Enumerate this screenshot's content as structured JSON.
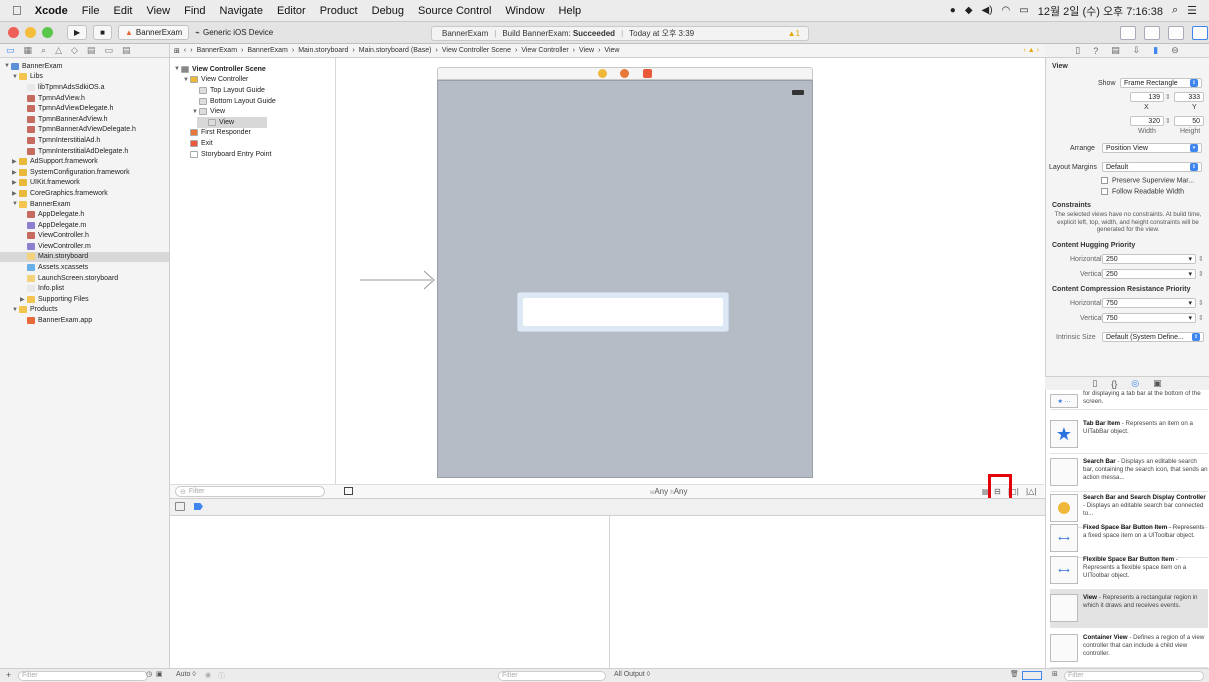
{
  "menubar": {
    "apple": "",
    "items": [
      "Xcode",
      "File",
      "Edit",
      "View",
      "Find",
      "Navigate",
      "Editor",
      "Product",
      "Debug",
      "Source Control",
      "Window",
      "Help"
    ],
    "clock": "12월 2일 (수) 오후 7:16:38"
  },
  "toolbar": {
    "scheme": "BannerExam",
    "device": "Generic iOS Device",
    "status_project": "BannerExam",
    "status_build": "Build BannerExam:",
    "status_result": "Succeeded",
    "status_time": "Today at 오후 3:39",
    "warning_count": "1"
  },
  "jumpbar": [
    "BannerExam",
    "BannerExam",
    "Main.storyboard",
    "Main.storyboard (Base)",
    "View Controller Scene",
    "View Controller",
    "View",
    "View"
  ],
  "navigator": {
    "items": [
      {
        "label": "BannerExam",
        "indent": 0,
        "tri": "▼",
        "color": "#5b8fd8",
        "sel": false
      },
      {
        "label": "Libs",
        "indent": 1,
        "tri": "▼",
        "color": "#f3c44e",
        "sel": false
      },
      {
        "label": "libTpmnAdsSdkiOS.a",
        "indent": 2,
        "tri": "",
        "color": "#e8e8e8",
        "sel": false
      },
      {
        "label": "TpmnAdView.h",
        "indent": 2,
        "tri": "",
        "color": "#c56b5f",
        "sel": false
      },
      {
        "label": "TpmnAdViewDelegate.h",
        "indent": 2,
        "tri": "",
        "color": "#c56b5f",
        "sel": false
      },
      {
        "label": "TpmnBannerAdView.h",
        "indent": 2,
        "tri": "",
        "color": "#c56b5f",
        "sel": false
      },
      {
        "label": "TpmnBannerAdViewDelegate.h",
        "indent": 2,
        "tri": "",
        "color": "#c56b5f",
        "sel": false
      },
      {
        "label": "TpmnInterstitialAd.h",
        "indent": 2,
        "tri": "",
        "color": "#c56b5f",
        "sel": false
      },
      {
        "label": "TpmnInterstitialAdDelegate.h",
        "indent": 2,
        "tri": "",
        "color": "#c56b5f",
        "sel": false
      },
      {
        "label": "AdSupport.framework",
        "indent": 1,
        "tri": "▶",
        "color": "#e8b93a",
        "sel": false
      },
      {
        "label": "SystemConfiguration.framework",
        "indent": 1,
        "tri": "▶",
        "color": "#e8b93a",
        "sel": false
      },
      {
        "label": "UIKit.framework",
        "indent": 1,
        "tri": "▶",
        "color": "#e8b93a",
        "sel": false
      },
      {
        "label": "CoreGraphics.framework",
        "indent": 1,
        "tri": "▶",
        "color": "#e8b93a",
        "sel": false
      },
      {
        "label": "BannerExam",
        "indent": 1,
        "tri": "▼",
        "color": "#f3c44e",
        "sel": false
      },
      {
        "label": "AppDelegate.h",
        "indent": 2,
        "tri": "",
        "color": "#c56b5f",
        "sel": false
      },
      {
        "label": "AppDelegate.m",
        "indent": 2,
        "tri": "",
        "color": "#8c7fd0",
        "sel": false
      },
      {
        "label": "ViewController.h",
        "indent": 2,
        "tri": "",
        "color": "#c56b5f",
        "sel": false
      },
      {
        "label": "ViewController.m",
        "indent": 2,
        "tri": "",
        "color": "#8c7fd0",
        "sel": false
      },
      {
        "label": "Main.storyboard",
        "indent": 2,
        "tri": "",
        "color": "#f3d27a",
        "sel": true
      },
      {
        "label": "Assets.xcassets",
        "indent": 2,
        "tri": "",
        "color": "#6ab0e8",
        "sel": false
      },
      {
        "label": "LaunchScreen.storyboard",
        "indent": 2,
        "tri": "",
        "color": "#f3d27a",
        "sel": false
      },
      {
        "label": "Info.plist",
        "indent": 2,
        "tri": "",
        "color": "#e8e8e8",
        "sel": false
      },
      {
        "label": "Supporting Files",
        "indent": 2,
        "tri": "▶",
        "color": "#f3c44e",
        "sel": false
      },
      {
        "label": "Products",
        "indent": 1,
        "tri": "▼",
        "color": "#f3c44e",
        "sel": false
      },
      {
        "label": "BannerExam.app",
        "indent": 2,
        "tri": "",
        "color": "#e86a3a",
        "sel": false
      }
    ],
    "filter_placeholder": "Filter"
  },
  "outline": {
    "items": [
      {
        "label": "View Controller Scene",
        "indent": 0,
        "tri": "▼",
        "color": "#888",
        "bold": true,
        "sel": false
      },
      {
        "label": "View Controller",
        "indent": 1,
        "tri": "▼",
        "color": "#f0b838",
        "bold": false,
        "sel": false
      },
      {
        "label": "Top Layout Guide",
        "indent": 2,
        "tri": "",
        "color": "#ddd",
        "bold": false,
        "sel": false
      },
      {
        "label": "Bottom Layout Guide",
        "indent": 2,
        "tri": "",
        "color": "#ddd",
        "bold": false,
        "sel": false
      },
      {
        "label": "View",
        "indent": 2,
        "tri": "▼",
        "color": "#ddd",
        "bold": false,
        "sel": false
      },
      {
        "label": "View",
        "indent": 3,
        "tri": "",
        "color": "#ddd",
        "bold": false,
        "sel": true
      },
      {
        "label": "First Responder",
        "indent": 1,
        "tri": "",
        "color": "#e8773a",
        "bold": false,
        "sel": false
      },
      {
        "label": "Exit",
        "indent": 1,
        "tri": "",
        "color": "#e85a3a",
        "bold": false,
        "sel": false
      },
      {
        "label": "Storyboard Entry Point",
        "indent": 1,
        "tri": "",
        "color": "#fff",
        "bold": false,
        "sel": false
      }
    ],
    "filter_placeholder": "Filter"
  },
  "canvas": {
    "size_class": "wAny hAny",
    "w_prefix": "w",
    "w_value": "Any",
    "h_prefix": "h",
    "h_value": "Any"
  },
  "debug": {
    "auto_label": "Auto ◊",
    "filter_placeholder": "Filter",
    "output_label": "All Output ◊"
  },
  "inspector": {
    "section": "View",
    "show_label": "Show",
    "show_value": "Frame Rectangle",
    "x": "139",
    "y": "333",
    "x_label": "X",
    "y_label": "Y",
    "width": "320",
    "height": "50",
    "width_label": "Width",
    "height_label": "Height",
    "arrange_label": "Arrange",
    "arrange_value": "Position View",
    "margins_label": "Layout Margins",
    "margins_value": "Default",
    "preserve_label": "Preserve Superview Mar...",
    "follow_label": "Follow Readable Width",
    "constraints_head": "Constraints",
    "constraints_text": "The selected views have no constraints. At build time, explicit left, top, width, and height constraints will be generated for the view.",
    "hugging_head": "Content Hugging Priority",
    "horizontal_label": "Horizontal",
    "vertical_label": "Vertical",
    "hug_h": "250",
    "hug_v": "250",
    "compression_head": "Content Compression Resistance Priority",
    "comp_h": "750",
    "comp_v": "750",
    "intrinsic_label": "Intrinsic Size",
    "intrinsic_value": "Default (System Define..."
  },
  "library": {
    "items": [
      {
        "title": "",
        "desc": "for displaying a tab bar at the bottom of the screen.",
        "icon": "tab-bar-icon"
      },
      {
        "title": "Tab Bar Item",
        "desc": " - Represents an item on a UITabBar object.",
        "icon": "star-icon"
      },
      {
        "title": "Search Bar",
        "desc": " - Displays an editable search bar, containing the search icon, that sends an action messa...",
        "icon": "search-bar-icon"
      },
      {
        "title": "Search Bar and Search Display Controller",
        "desc": " - Displays an editable search bar connected to...",
        "icon": "search-display-icon"
      },
      {
        "title": "Fixed Space Bar Button Item",
        "desc": " - Represents a fixed space item on a UIToolbar object.",
        "icon": "fixed-space-icon"
      },
      {
        "title": "Flexible Space Bar Button Item",
        "desc": " - Represents a flexible space item on a UIToolbar object.",
        "icon": "flexible-space-icon"
      },
      {
        "title": "View",
        "desc": " - Represents a rectangular region in which it draws and receives events.",
        "icon": "view-icon"
      },
      {
        "title": "Container View",
        "desc": " - Defines a region of a view controller that can include a child view controller.",
        "icon": "container-view-icon"
      }
    ],
    "filter_placeholder": "Filter"
  }
}
